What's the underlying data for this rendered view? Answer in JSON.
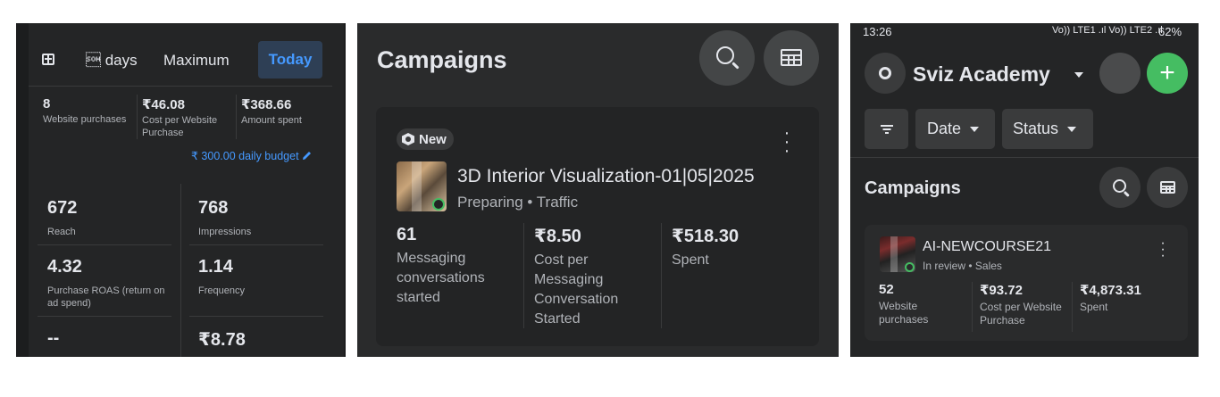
{
  "panel1": {
    "date_tab": "\u0001 days",
    "max_tab": "Maximum",
    "today_tab": "Today",
    "stats": [
      {
        "value": "8",
        "label": "Website purchases"
      },
      {
        "value": "₹46.08",
        "label": "Cost per Website Purchase"
      },
      {
        "value": "₹368.66",
        "label": "Amount spent"
      }
    ],
    "budget": "₹ 300.00 daily budget",
    "metrics": [
      {
        "value": "672",
        "label": "Reach"
      },
      {
        "value": "768",
        "label": "Impressions"
      },
      {
        "value": "4.32",
        "label": "Purchase ROAS (return on ad spend)"
      },
      {
        "value": "1.14",
        "label": "Frequency"
      },
      {
        "value": "--",
        "label": ""
      },
      {
        "value": "₹8.78",
        "label": ""
      }
    ]
  },
  "panel2": {
    "title": "Campaigns",
    "badge": "New",
    "campaign_name": "3D Interior Visualization-01|05|2025",
    "campaign_sub": "Preparing • Traffic",
    "metrics": [
      {
        "value": "61",
        "label": "Messaging conversations started"
      },
      {
        "value": "₹8.50",
        "label": "Cost per Messaging Conversation Started"
      },
      {
        "value": "₹518.30",
        "label": "Spent"
      }
    ]
  },
  "panel3": {
    "time": "13:26",
    "signal": "Vo)) LTE1 .ıl Vo)) LTE2 .ıl",
    "battery": "62%",
    "account": "Sviz Academy",
    "date_filter": "Date",
    "status_filter": "Status",
    "section_title": "Campaigns",
    "campaign_name": "AI-NEWCOURSE21",
    "campaign_sub": "In review • Sales",
    "metrics": [
      {
        "value": "52",
        "label": "Website purchases"
      },
      {
        "value": "₹93.72",
        "label": "Cost per Website Purchase"
      },
      {
        "value": "₹4,873.31",
        "label": "Spent"
      }
    ]
  },
  "colors": {
    "accent_blue": "#4599ff",
    "active_green": "#45bd62",
    "bg_dark": "#242526"
  },
  "icons": [
    "calendar-icon",
    "pencil-icon",
    "new-hexagon-icon",
    "more-vert-icon",
    "search-icon",
    "table-icon",
    "gear-icon",
    "plus-icon",
    "filter-icon",
    "chevron-down-icon"
  ]
}
